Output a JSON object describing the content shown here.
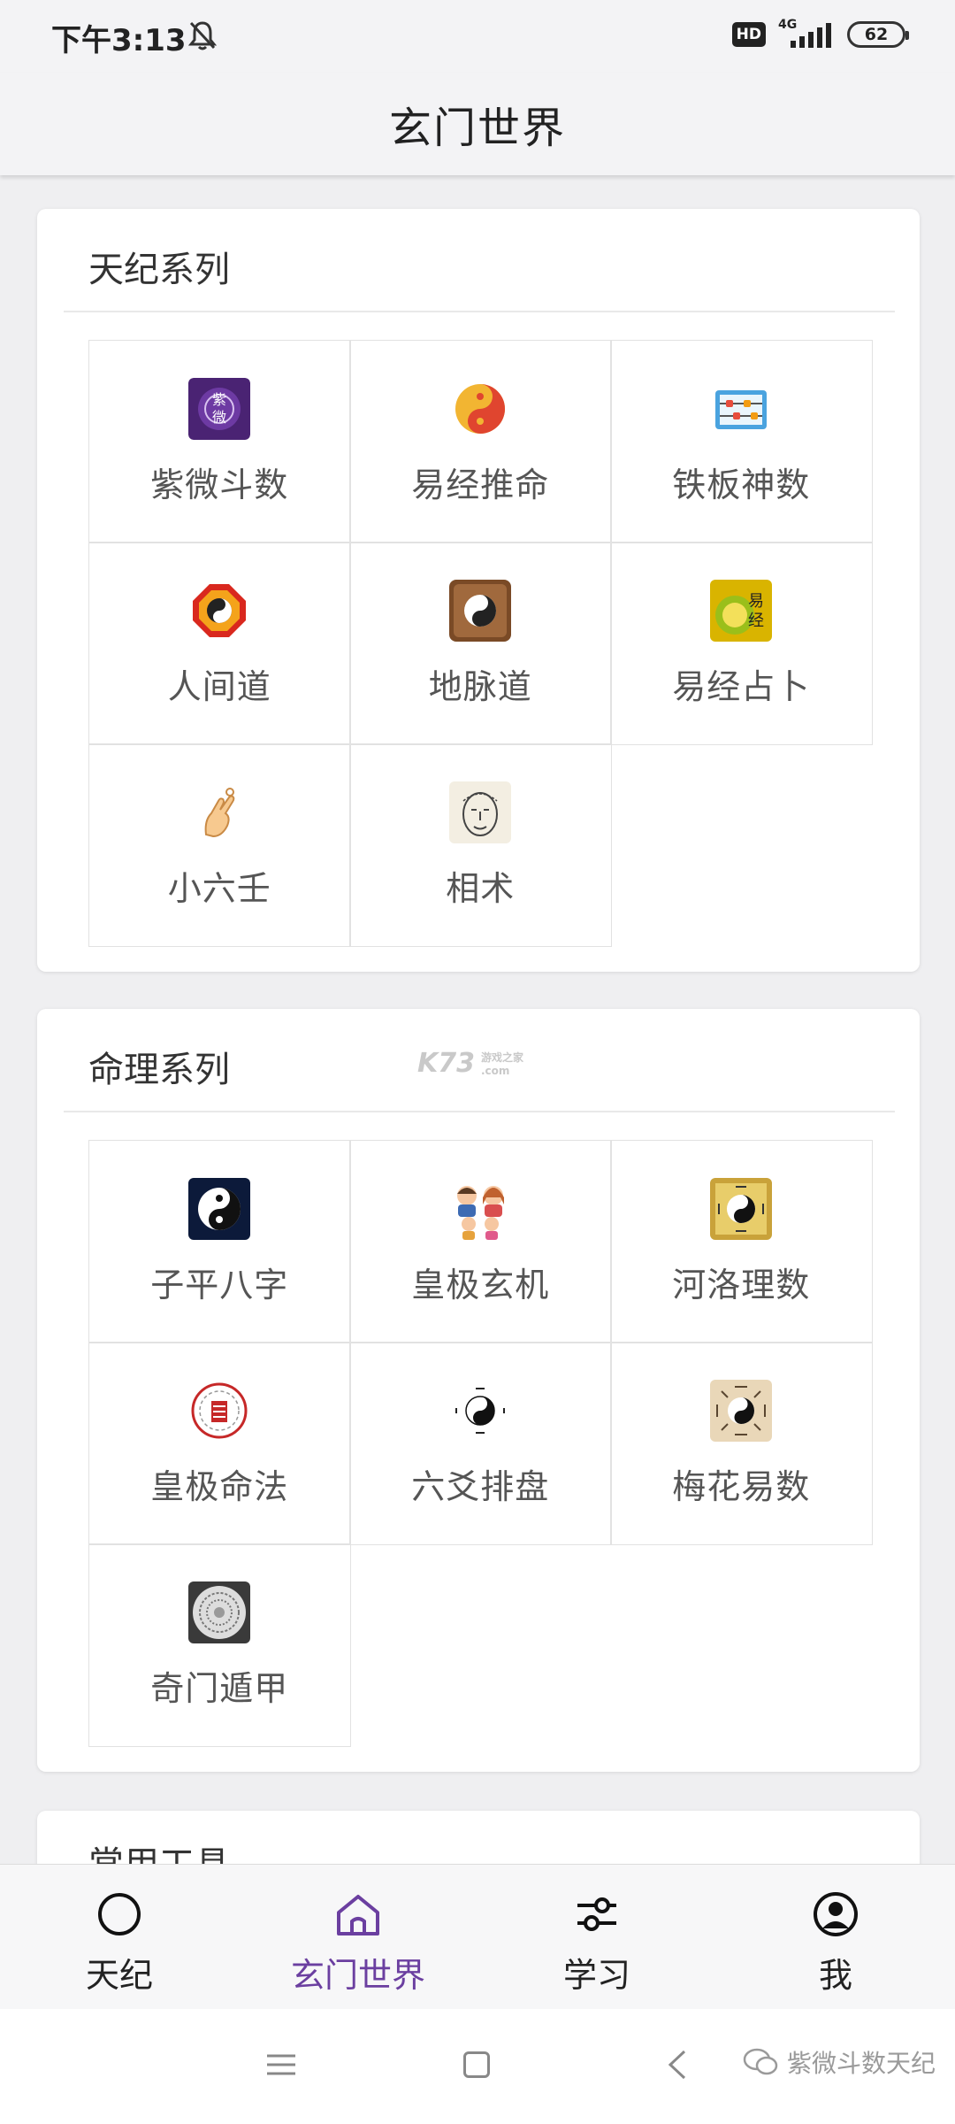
{
  "status_bar": {
    "time": "下午3:13",
    "hd_label": "HD",
    "network_label": "4G",
    "battery": "62"
  },
  "app_bar": {
    "title": "玄门世界"
  },
  "sections": [
    {
      "title": "天纪系列",
      "items": [
        {
          "label": "紫微斗数",
          "icon": "ziwei-icon"
        },
        {
          "label": "易经推命",
          "icon": "yinyang-icon"
        },
        {
          "label": "铁板神数",
          "icon": "abacus-icon"
        },
        {
          "label": "人间道",
          "icon": "bagua-icon"
        },
        {
          "label": "地脉道",
          "icon": "dimai-icon"
        },
        {
          "label": "易经占卜",
          "icon": "yijing-icon"
        },
        {
          "label": "小六壬",
          "icon": "hand-icon"
        },
        {
          "label": "相术",
          "icon": "face-reading-icon"
        }
      ]
    },
    {
      "title": "命理系列",
      "watermark": "K73",
      "watermark_sub": "游戏之家 .com",
      "items": [
        {
          "label": "子平八字",
          "icon": "yinyang-dark-icon"
        },
        {
          "label": "皇极玄机",
          "icon": "family-icon"
        },
        {
          "label": "河洛理数",
          "icon": "heluo-icon"
        },
        {
          "label": "皇极命法",
          "icon": "seal-icon"
        },
        {
          "label": "六爻排盘",
          "icon": "taichi-icon"
        },
        {
          "label": "梅花易数",
          "icon": "meihua-icon"
        },
        {
          "label": "奇门遁甲",
          "icon": "compass-icon"
        }
      ]
    },
    {
      "title": "常用工具"
    }
  ],
  "bottom_nav": [
    {
      "label": "天纪",
      "icon": "circle-icon",
      "active": false
    },
    {
      "label": "玄门世界",
      "icon": "home-icon",
      "active": true
    },
    {
      "label": "学习",
      "icon": "sliders-icon",
      "active": false
    },
    {
      "label": "我",
      "icon": "profile-icon",
      "active": false
    }
  ],
  "overlay_watermark": "紫微斗数天纪",
  "colors": {
    "accent": "#6b3fa0",
    "background": "#efeff1"
  }
}
